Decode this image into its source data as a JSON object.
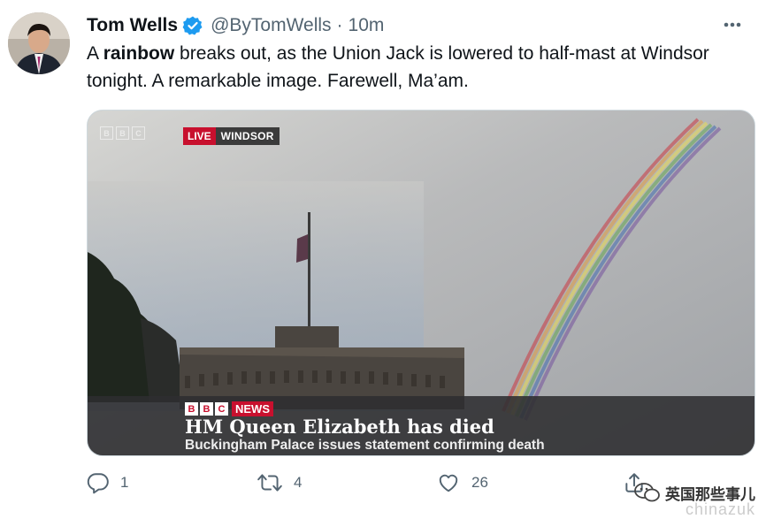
{
  "tweet": {
    "author": {
      "display_name": "Tom Wells",
      "handle": "@ByTomWells",
      "verified": true
    },
    "separator": "·",
    "time": "10m",
    "text": {
      "part1": "A ",
      "bold": "rainbow",
      "part2": " breaks out, as the Union Jack is lowered to half-mast at Windsor tonight. A remarkable image. Farewell, Ma’am."
    }
  },
  "media": {
    "corner_logo": [
      "B",
      "B",
      "C"
    ],
    "live_label": "LIVE",
    "live_location": "WINDSOR",
    "bbc_blocks": [
      "B",
      "B",
      "C"
    ],
    "news_label": "NEWS",
    "headline": "HM Queen Elizabeth has died",
    "subline": "Buckingham Palace issues statement confirming death"
  },
  "actions": {
    "replies": "1",
    "retweets": "4",
    "likes": "26"
  },
  "watermark": {
    "text": "英国那些事儿",
    "sub": "chinazuk"
  },
  "colors": {
    "verified": "#1d9bf0",
    "bbc_red": "#c8102e",
    "muted": "#536471"
  },
  "icons": [
    "verified-badge-icon",
    "more-icon",
    "reply-icon",
    "retweet-icon",
    "like-icon",
    "share-icon",
    "wechat-icon"
  ]
}
